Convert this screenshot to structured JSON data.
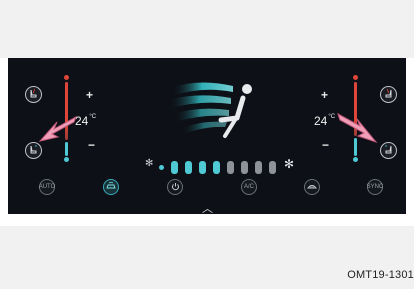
{
  "left_zone": {
    "temperature": "24",
    "unit": "°C",
    "plus": "+",
    "minus": "−"
  },
  "right_zone": {
    "temperature": "24",
    "unit": "°C",
    "plus": "+",
    "minus": "−"
  },
  "fan": {
    "level": 4,
    "max_level": 8,
    "active_color": "#4fc9d3",
    "inactive_color": "#8e939b"
  },
  "bottom_buttons": {
    "auto": "AUTO",
    "ac": "A/C",
    "sync": "SYNC"
  },
  "colors": {
    "hot": "#e0453a",
    "cold": "#4fc9d3",
    "arrow": "#f19fb8",
    "accent": "#3aa9b8"
  },
  "figure_code": "OMT19-1301"
}
